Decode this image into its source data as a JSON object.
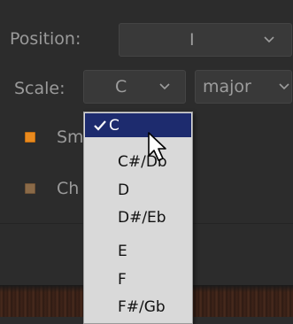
{
  "position": {
    "label": "Position:",
    "value": "I"
  },
  "scale": {
    "label": "Scale:",
    "key_value": "C",
    "mode_value": "major"
  },
  "options": {
    "smooth_label": "Sm",
    "chord_label": "Ch"
  },
  "dropdown": {
    "items": [
      "C",
      "C#/Db",
      "D",
      "D#/Eb",
      "E",
      "F",
      "F#/Gb"
    ],
    "selected_index": 0
  },
  "colors": {
    "panel_bg": "#2c2c2c",
    "combo_bg": "#393939",
    "label_text": "#9a9a9a",
    "dropdown_bg": "#d9d9d9",
    "selection_bg": "#1d2b6e",
    "checkbox_on": "#e98a1e",
    "checkbox_off": "#8a6a48"
  }
}
